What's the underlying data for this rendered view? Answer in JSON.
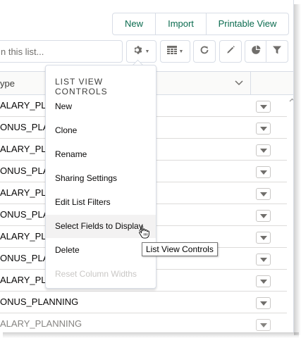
{
  "actions": {
    "new": "New",
    "import": "Import",
    "printable": "Printable View"
  },
  "search": {
    "placeholder": "n this list..."
  },
  "toolbar": {
    "settings_icon": "gear-icon",
    "display_icon": "table-icon",
    "refresh_icon": "refresh-icon",
    "edit_icon": "pencil-icon",
    "charts_icon": "pie-chart-icon",
    "filter_icon": "filter-icon"
  },
  "table": {
    "header": {
      "type_label": "ype"
    },
    "rows": [
      "ALARY_PLA",
      "ONUS_PLAI",
      "ALARY_PLA",
      "ONUS_PLAI",
      "ALARY_PLA",
      "ONUS_PLAI",
      "ALARY_PLA",
      "ONUS_PLAI",
      "ALARY_PLA",
      "ONUS_PLANNING",
      "ALARY_PLANNING"
    ]
  },
  "menu": {
    "title": "LIST VIEW CONTROLS",
    "items": [
      {
        "label": "New"
      },
      {
        "label": "Clone"
      },
      {
        "label": "Rename"
      },
      {
        "label": "Sharing Settings"
      },
      {
        "label": "Edit List Filters"
      },
      {
        "label": "Select Fields to Display"
      },
      {
        "label": "Delete"
      },
      {
        "label": "Reset Column Widths"
      }
    ]
  },
  "tooltip": {
    "text": "List View Controls"
  },
  "colors": {
    "accent": "#0b6b4f",
    "border": "#d8dde6",
    "hover": "#f3f2f2"
  }
}
